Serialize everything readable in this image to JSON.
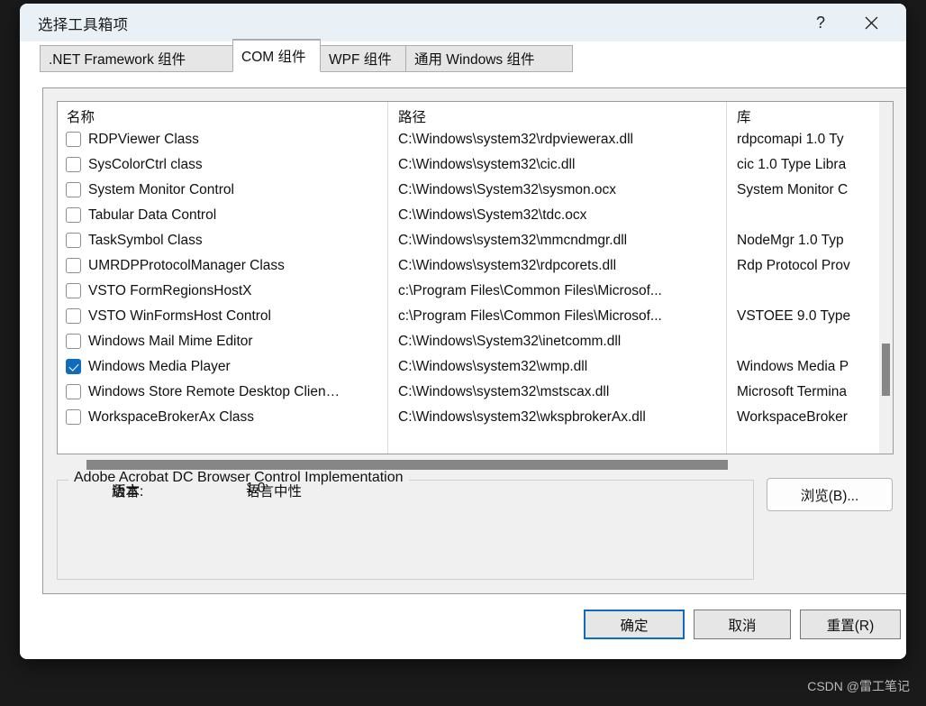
{
  "window": {
    "title": "选择工具箱项",
    "help_icon": "question-mark-icon",
    "close_icon": "close-icon"
  },
  "tabs": [
    {
      "label": ".NET Framework 组件",
      "active": false
    },
    {
      "label": "COM 组件",
      "active": true
    },
    {
      "label": "WPF 组件",
      "active": false
    },
    {
      "label": "通用 Windows 组件",
      "active": false
    }
  ],
  "list": {
    "columns": {
      "name": "名称",
      "path": "路径",
      "library": "库"
    },
    "rows": [
      {
        "checked": false,
        "name": "RDPViewer Class",
        "path": "C:\\Windows\\system32\\rdpviewerax.dll",
        "library": "rdpcomapi 1.0 Ty"
      },
      {
        "checked": false,
        "name": "SysColorCtrl class",
        "path": "C:\\Windows\\system32\\cic.dll",
        "library": "cic 1.0 Type Libra"
      },
      {
        "checked": false,
        "name": "System Monitor Control",
        "path": "C:\\Windows\\System32\\sysmon.ocx",
        "library": "System Monitor C"
      },
      {
        "checked": false,
        "name": "Tabular Data Control",
        "path": "C:\\Windows\\System32\\tdc.ocx",
        "library": ""
      },
      {
        "checked": false,
        "name": "TaskSymbol Class",
        "path": "C:\\Windows\\system32\\mmcndmgr.dll",
        "library": "NodeMgr 1.0 Typ"
      },
      {
        "checked": false,
        "name": "UMRDPProtocolManager  Class",
        "path": "C:\\Windows\\system32\\rdpcorets.dll",
        "library": "Rdp Protocol Prov"
      },
      {
        "checked": false,
        "name": "VSTO FormRegionsHostX",
        "path": "c:\\Program Files\\Common Files\\Microsof...",
        "library": ""
      },
      {
        "checked": false,
        "name": "VSTO WinFormsHost Control",
        "path": "c:\\Program Files\\Common Files\\Microsof...",
        "library": "VSTOEE 9.0 Type"
      },
      {
        "checked": false,
        "name": "Windows Mail Mime Editor",
        "path": "C:\\Windows\\System32\\inetcomm.dll",
        "library": ""
      },
      {
        "checked": true,
        "name": "Windows Media Player",
        "path": "C:\\Windows\\system32\\wmp.dll",
        "library": "Windows Media P"
      },
      {
        "checked": false,
        "name": "Windows Store Remote Desktop Clien…",
        "path": "C:\\Windows\\system32\\mstscax.dll",
        "library": "Microsoft Termina"
      },
      {
        "checked": false,
        "name": "WorkspaceBrokerAx Class",
        "path": "C:\\Windows\\system32\\wkspbrokerAx.dll",
        "library": "WorkspaceBroker"
      }
    ]
  },
  "info": {
    "title": "Adobe Acrobat DC Browser Control Implementation",
    "language_label": "语言:",
    "language_value": "语言中性",
    "version_label": "版本:",
    "version_value": "1.0"
  },
  "buttons": {
    "browse": "浏览(B)...",
    "ok": "确定",
    "cancel": "取消",
    "reset": "重置(R)"
  },
  "watermark": "CSDN @雷工笔记",
  "colors": {
    "accent": "#0f6cbd",
    "titlebar": "#eaf1f6",
    "page": "#f0f0f0",
    "desktop": "#1a1a1a"
  }
}
